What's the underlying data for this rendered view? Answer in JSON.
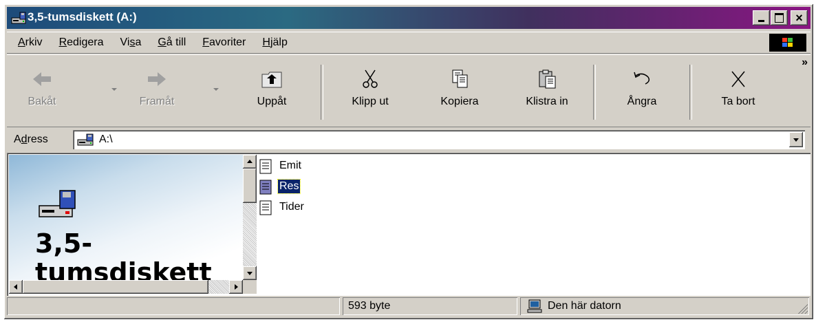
{
  "window": {
    "title": "3,5-tumsdiskett (A:)",
    "icon": "floppy-drive-icon",
    "controls": {
      "minimize": "minimize-icon",
      "maximize": "maximize-icon",
      "close": "×"
    }
  },
  "menu": {
    "items": [
      {
        "label": "Arkiv",
        "accel_index": 0
      },
      {
        "label": "Redigera",
        "accel_index": 0
      },
      {
        "label": "Visa",
        "accel_index": 2
      },
      {
        "label": "Gå till",
        "accel_index": 0
      },
      {
        "label": "Favoriter",
        "accel_index": 0
      },
      {
        "label": "Hjälp",
        "accel_index": 0
      }
    ]
  },
  "toolbar": {
    "back": "Bakåt",
    "forward": "Framåt",
    "up": "Uppåt",
    "cut": "Klipp ut",
    "copy": "Kopiera",
    "paste": "Klistra in",
    "undo": "Ångra",
    "delete": "Ta bort",
    "more": "»",
    "disabled": [
      "back",
      "forward"
    ]
  },
  "address": {
    "label_pre": "A",
    "label_accel": "d",
    "label_post": "ress",
    "value": "A:\\"
  },
  "leftpane": {
    "title_line1": "3,5-",
    "title_line2": "tumsdiskett"
  },
  "files": [
    {
      "name": "Emit",
      "selected": false
    },
    {
      "name": "Res",
      "selected": true
    },
    {
      "name": "Tider",
      "selected": false
    }
  ],
  "status": {
    "panel1": "",
    "size": "593 byte",
    "zone": "Den här datorn"
  },
  "colors": {
    "title_gradient_start": "#1d4b7a",
    "title_gradient_end": "#8a1583",
    "selection": "#0a246a",
    "face": "#d4d0c8"
  }
}
